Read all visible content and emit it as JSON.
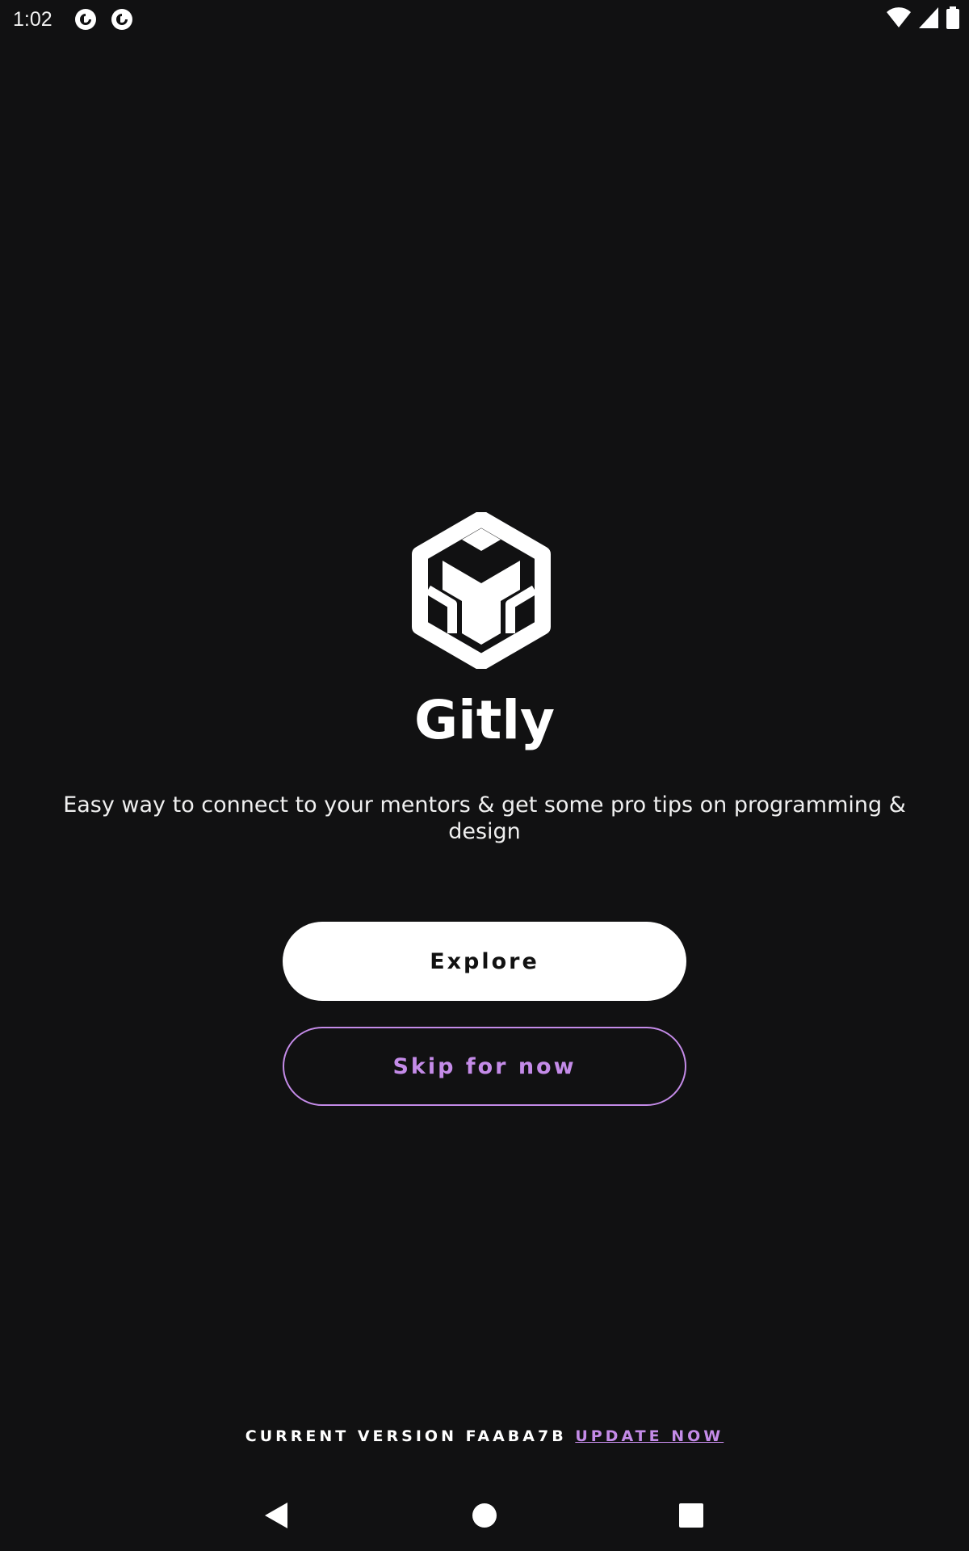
{
  "status_bar": {
    "time": "1:02",
    "notification_icons": [
      "pocket-casts-icon",
      "pocket-casts-icon"
    ],
    "right_icons": [
      "wifi-icon",
      "cell-signal-icon",
      "battery-icon"
    ]
  },
  "app": {
    "logo_icon": "hexagon-cube-logo-icon",
    "name": "Gitly",
    "tagline": "Easy way to connect to your mentors & get some pro tips on programming & design"
  },
  "actions": {
    "explore_label": "Explore",
    "skip_label": "Skip for now"
  },
  "footer": {
    "version_label": "CURRENT VERSION FAABA7B",
    "update_link": "UPDATE NOW"
  },
  "nav_bar": {
    "icons": [
      "back-icon",
      "home-icon",
      "recents-icon"
    ]
  },
  "colors": {
    "background": "#111112",
    "accent": "#c48be8",
    "text": "#ffffff"
  }
}
